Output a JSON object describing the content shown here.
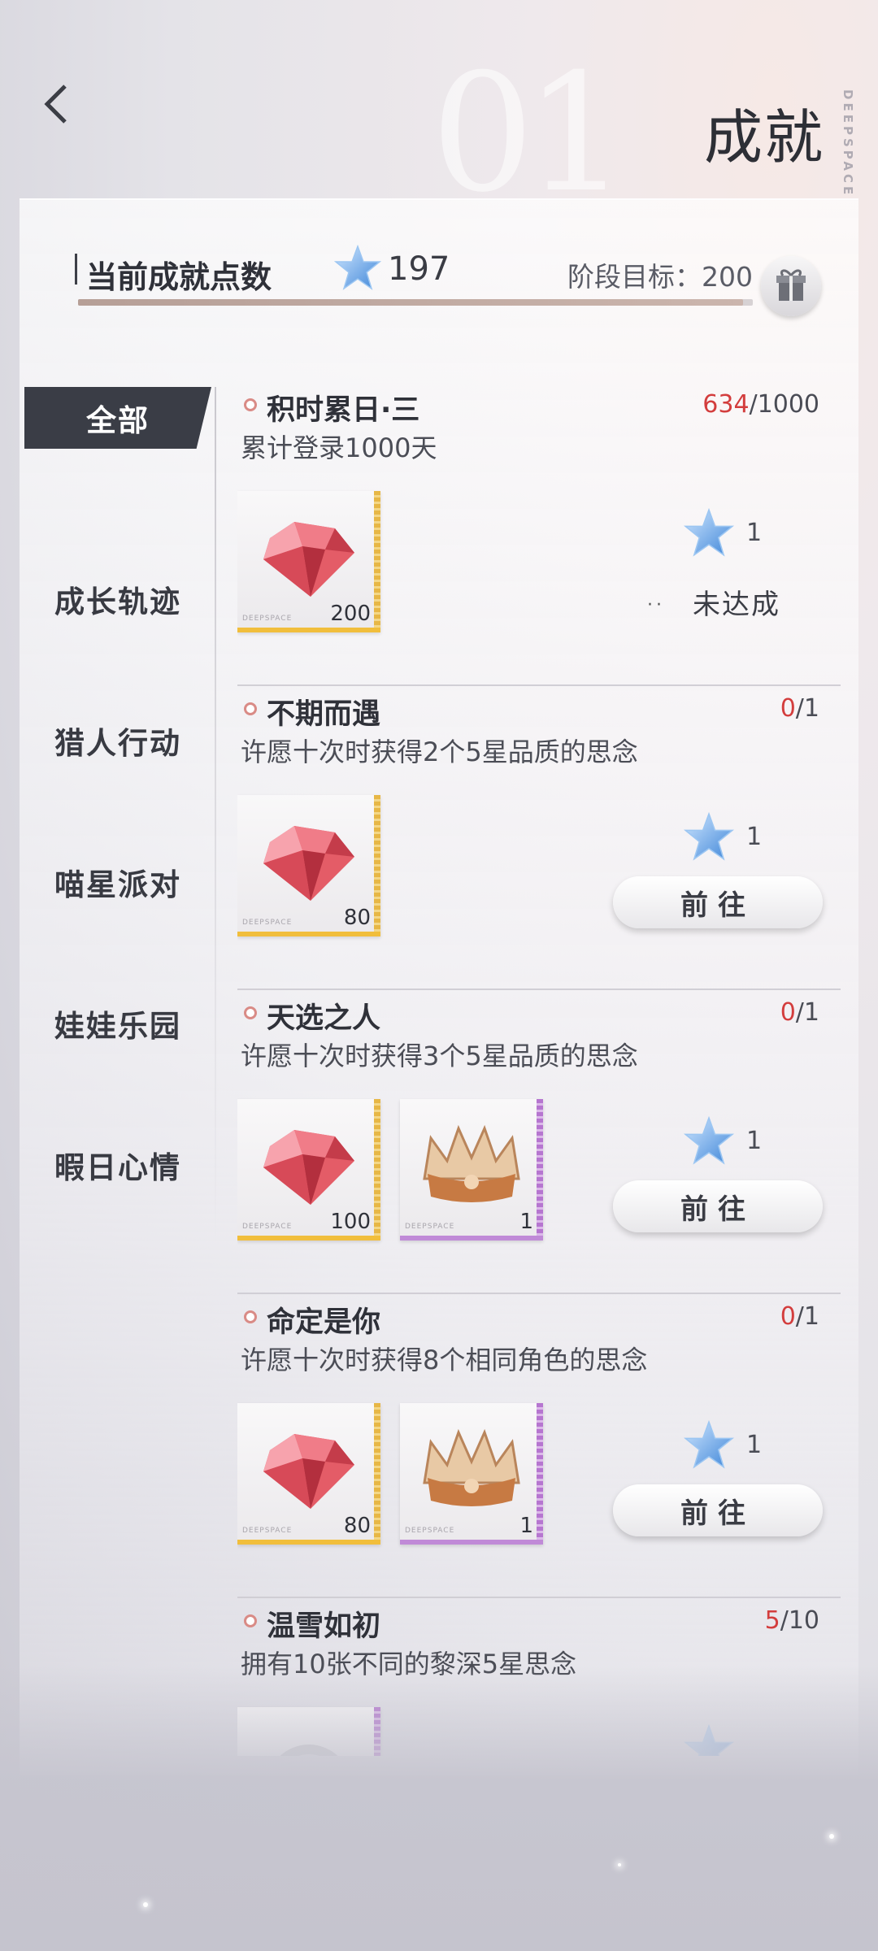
{
  "header": {
    "title": "成就",
    "bg_watermark": "DEEPSPACE"
  },
  "summary": {
    "label": "当前成就点数",
    "points": "197",
    "stage_goal": "阶段目标：200",
    "progress_fraction": 0.985
  },
  "sidebar": {
    "items": [
      {
        "label": "全部",
        "active": true
      },
      {
        "label": "成长轨迹"
      },
      {
        "label": "猎人行动"
      },
      {
        "label": "喵星派对"
      },
      {
        "label": "娃娃乐园"
      },
      {
        "label": "暇日心情"
      }
    ]
  },
  "achievements": [
    {
      "title": "积时累日·三",
      "progress_current": "634",
      "progress_total": "/1000",
      "description": "累计登录1000天",
      "rewards": [
        {
          "type": "gem",
          "count": "200",
          "rarity": "gold"
        }
      ],
      "star_reward": "1",
      "status": "未达成",
      "status_dots": "··"
    },
    {
      "title": "不期而遇",
      "progress_current": "0",
      "progress_total": "/1",
      "description": "许愿十次时获得2个5星品质的思念",
      "rewards": [
        {
          "type": "gem",
          "count": "80",
          "rarity": "gold"
        }
      ],
      "star_reward": "1",
      "button": "前往"
    },
    {
      "title": "天选之人",
      "progress_current": "0",
      "progress_total": "/1",
      "description": "许愿十次时获得3个5星品质的思念",
      "rewards": [
        {
          "type": "gem",
          "count": "100",
          "rarity": "gold"
        },
        {
          "type": "crown",
          "count": "1",
          "rarity": "purple"
        }
      ],
      "star_reward": "1",
      "button": "前往"
    },
    {
      "title": "命定是你",
      "progress_current": "0",
      "progress_total": "/1",
      "description": "许愿十次时获得8个相同角色的思念",
      "rewards": [
        {
          "type": "gem",
          "count": "80",
          "rarity": "gold"
        },
        {
          "type": "crown",
          "count": "1",
          "rarity": "purple"
        }
      ],
      "star_reward": "1",
      "button": "前往"
    },
    {
      "title": "温雪如初",
      "progress_current": "5",
      "progress_total": "/10",
      "description": "拥有10张不同的黎深5星思念",
      "rewards": [
        {
          "type": "orb",
          "count": "",
          "rarity": "purple"
        }
      ],
      "star_reward": ""
    }
  ],
  "reward_card_watermark": "DEEPSPACE",
  "colors": {
    "accent_red": "#d33d3d",
    "sidebar_active": "#3a3d46",
    "gold_rarity": "#f1be3c",
    "purple_rarity": "#c08ad7",
    "star_blue": "#5aa2e6"
  },
  "icons": {
    "back": "chevron-left-icon",
    "star": "star-icon",
    "gift": "gift-icon",
    "gem": "red-gem-icon",
    "crown": "crown-icon"
  }
}
